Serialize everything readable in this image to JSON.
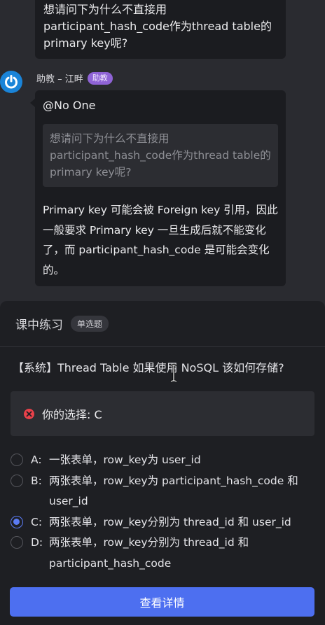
{
  "chat": {
    "previous_message": {
      "text": "想请问下为什么不直接用participant_hash_code作为thread table的primary key呢?"
    },
    "reply": {
      "sender_name": "助教 – 江畔",
      "role_badge": "助教",
      "mention": "@No One",
      "quote": "想请问下为什么不直接用participant_hash_code作为thread table的primary key呢?",
      "answer": "Primary key 可能会被 Foreign key 引用，因此一般要求 Primary key 一旦生成后就不能变化了，而 participant_hash_code 是可能会变化的。"
    }
  },
  "exercise": {
    "title": "课中练习",
    "type_badge": "单选题",
    "question": "【系统】Thread Table 如果使用 NoSQL 该如何存储?",
    "your_choice": "你的选择: C",
    "options": [
      {
        "letter": "A:",
        "text": "一张表单，row_key为 user_id",
        "selected": false
      },
      {
        "letter": "B:",
        "text": "两张表单，row_key为 participant_hash_code 和 user_id",
        "selected": false
      },
      {
        "letter": "C:",
        "text": "两张表单，row_key分别为 thread_id 和 user_id",
        "selected": true
      },
      {
        "letter": "D:",
        "text": "两张表单，row_key分别为 thread_id 和 participant_hash_code",
        "selected": false
      }
    ],
    "detail_button": "查看详情"
  },
  "colors": {
    "accent": "#4d6ff0",
    "error": "#e8414a",
    "badge_purple": "#8f63d6",
    "avatar_blue": "#1a84d8"
  },
  "icons": {
    "avatar": "power-icon",
    "wrong": "close-circle-icon",
    "cursor": "text-cursor-icon"
  }
}
